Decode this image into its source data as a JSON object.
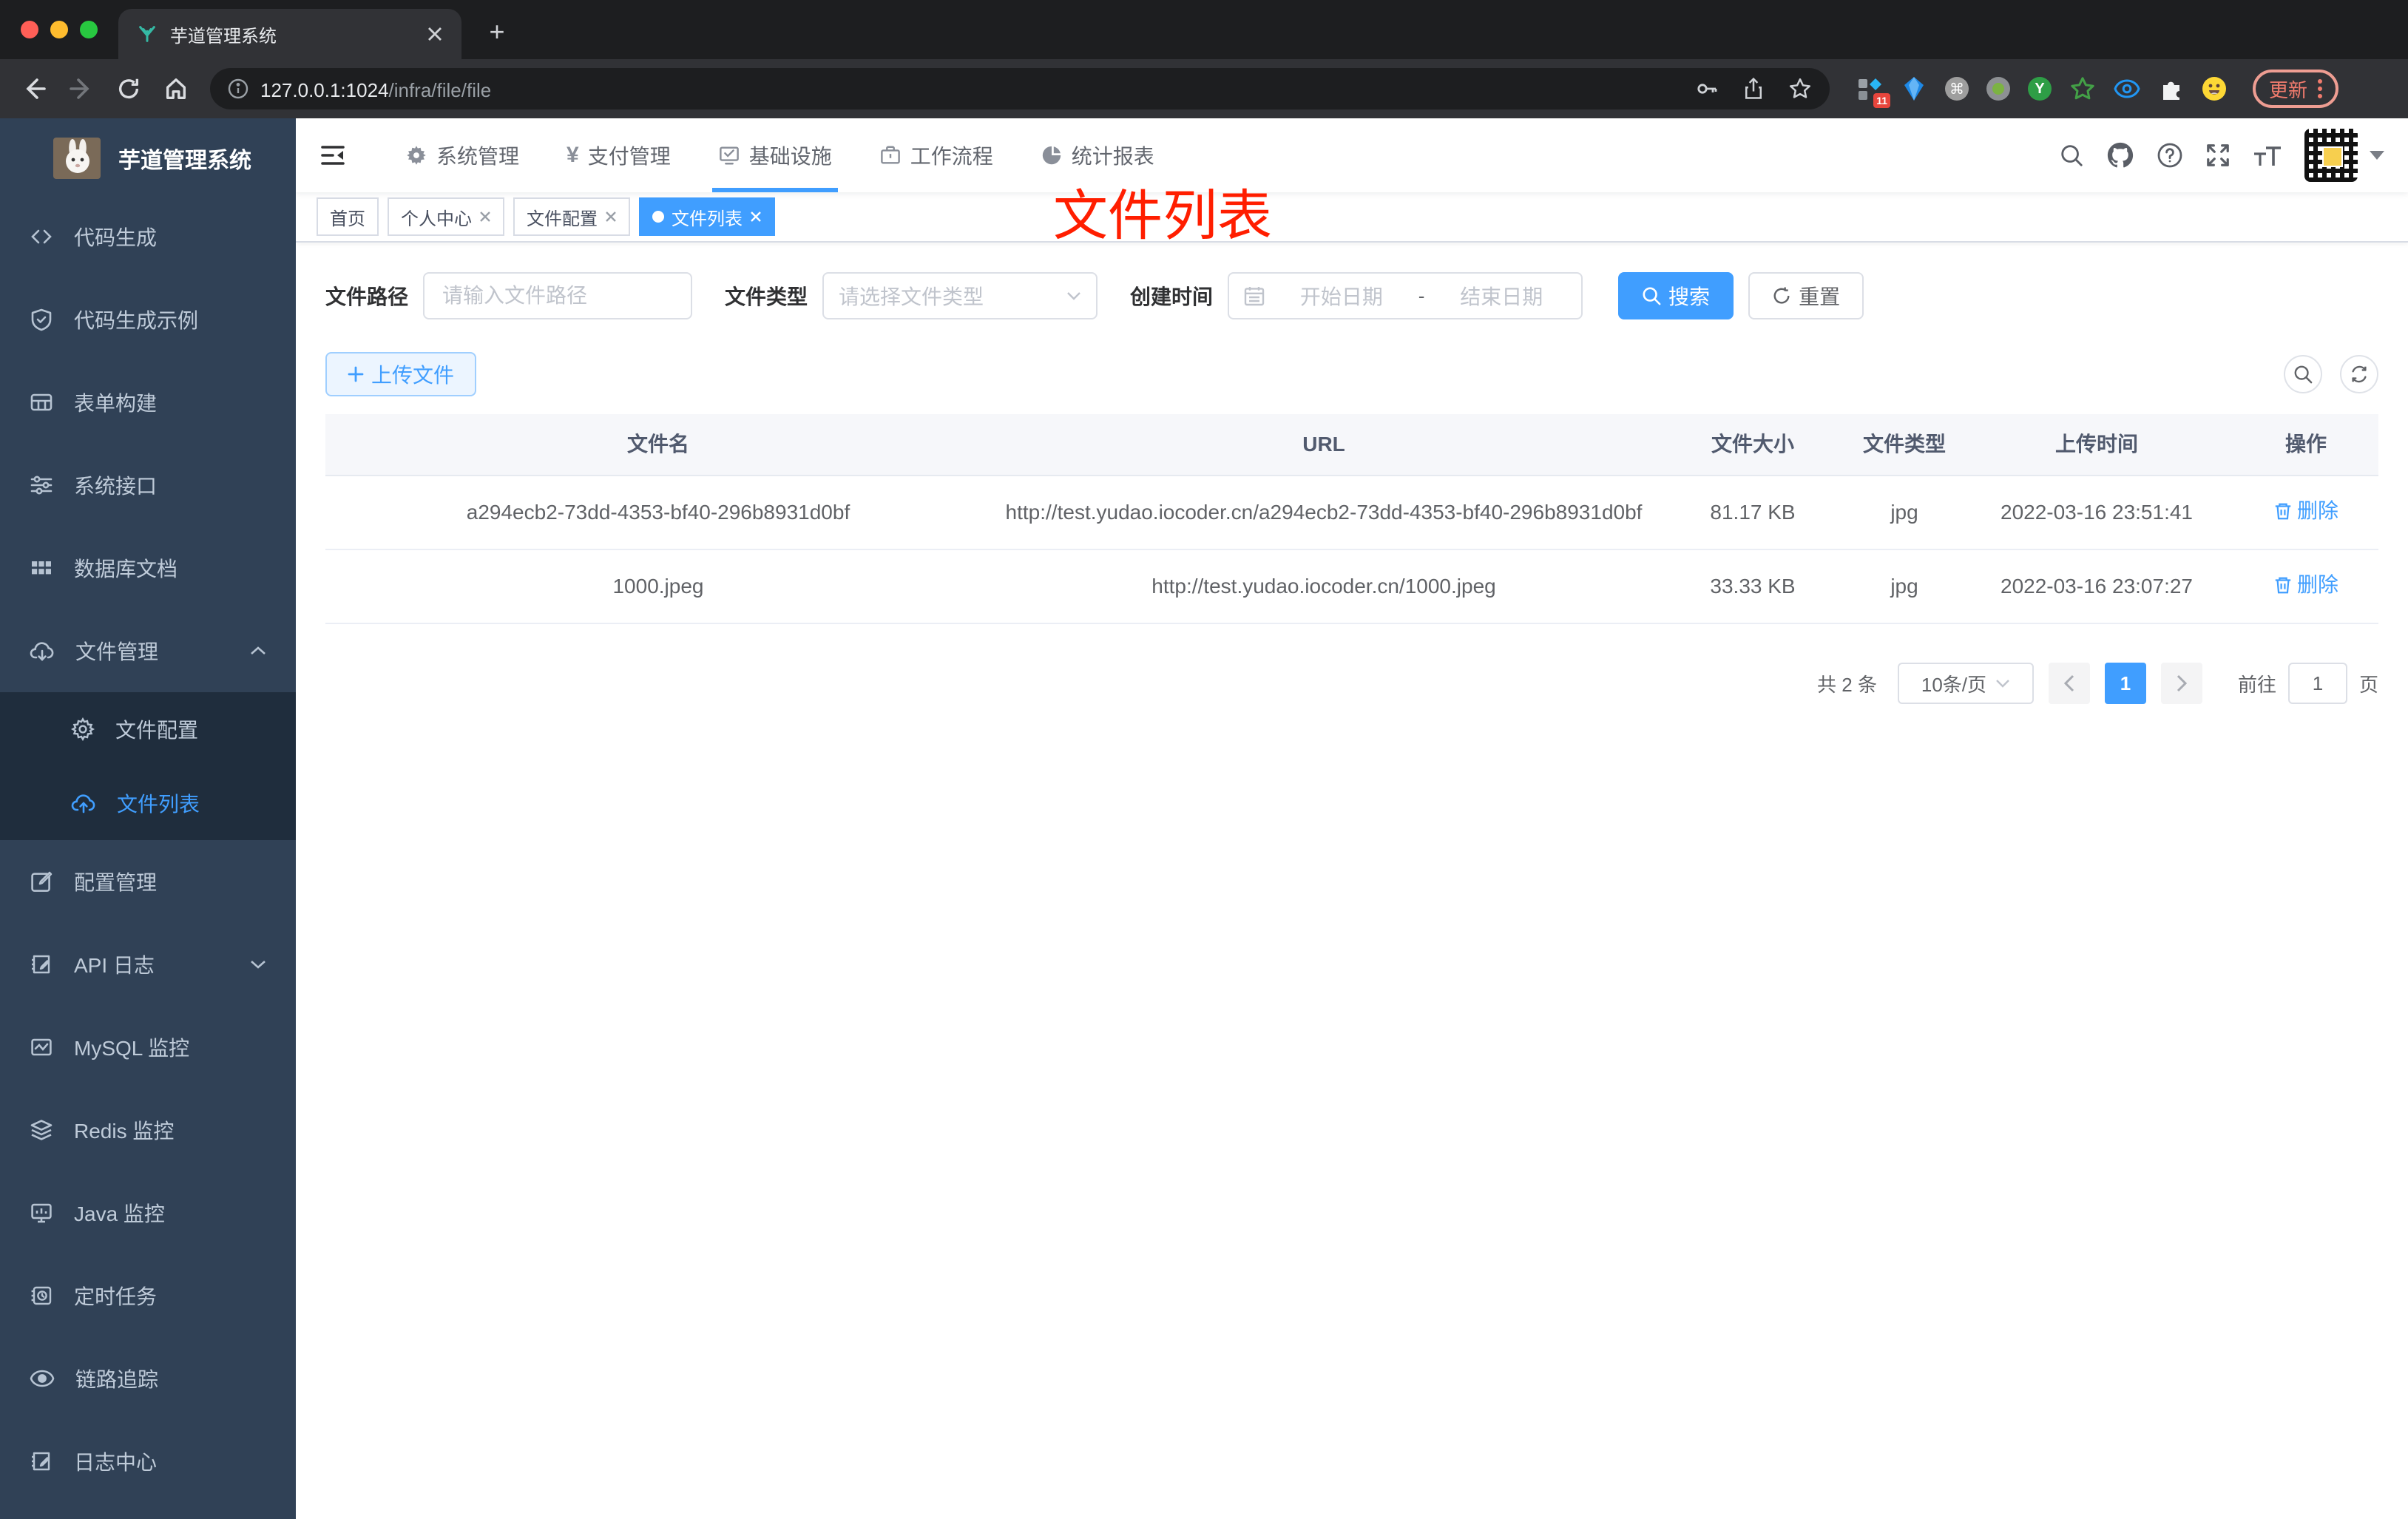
{
  "colors": {
    "accent": "#409eff",
    "annotation_red": "#ff1e00",
    "sidebar_bg": "#304156",
    "submenu_bg": "#1f2d3d"
  },
  "browser": {
    "tab_title": "芋道管理系统",
    "url_host": "127.0.0.1:1024",
    "url_path": "/infra/file/file",
    "ext_badge": "11",
    "update_label": "更新"
  },
  "sidebar": {
    "title": "芋道管理系统",
    "items": [
      {
        "label": "代码生成"
      },
      {
        "label": "代码生成示例"
      },
      {
        "label": "表单构建"
      },
      {
        "label": "系统接口"
      },
      {
        "label": "数据库文档"
      },
      {
        "label": "文件管理"
      },
      {
        "label": "文件配置"
      },
      {
        "label": "文件列表"
      },
      {
        "label": "配置管理"
      },
      {
        "label": "API 日志"
      },
      {
        "label": "MySQL 监控"
      },
      {
        "label": "Redis 监控"
      },
      {
        "label": "Java 监控"
      },
      {
        "label": "定时任务"
      },
      {
        "label": "链路追踪"
      },
      {
        "label": "日志中心"
      }
    ]
  },
  "topnav": {
    "items": [
      {
        "label": "系统管理"
      },
      {
        "label": "支付管理"
      },
      {
        "label": "基础设施"
      },
      {
        "label": "工作流程"
      },
      {
        "label": "统计报表"
      }
    ]
  },
  "tags": {
    "items": [
      {
        "label": "首页"
      },
      {
        "label": "个人中心"
      },
      {
        "label": "文件配置"
      },
      {
        "label": "文件列表"
      }
    ]
  },
  "annotation": {
    "text": "文件列表"
  },
  "filter": {
    "path_label": "文件路径",
    "path_placeholder": "请输入文件路径",
    "type_label": "文件类型",
    "type_placeholder": "请选择文件类型",
    "time_label": "创建时间",
    "start_placeholder": "开始日期",
    "range_separator": "-",
    "end_placeholder": "结束日期",
    "search_label": "搜索",
    "reset_label": "重置"
  },
  "actions": {
    "upload_label": "上传文件"
  },
  "table": {
    "columns": [
      {
        "label": "文件名"
      },
      {
        "label": "URL"
      },
      {
        "label": "文件大小"
      },
      {
        "label": "文件类型"
      },
      {
        "label": "上传时间"
      },
      {
        "label": "操作"
      }
    ],
    "rows": [
      {
        "name": "a294ecb2-73dd-4353-bf40-296b8931d0bf",
        "url": "http://test.yudao.iocoder.cn/a294ecb2-73dd-4353-bf40-296b8931d0bf",
        "size": "81.17 KB",
        "type": "jpg",
        "time": "2022-03-16 23:51:41",
        "action": "删除"
      },
      {
        "name": "1000.jpeg",
        "url": "http://test.yudao.iocoder.cn/1000.jpeg",
        "size": "33.33 KB",
        "type": "jpg",
        "time": "2022-03-16 23:07:27",
        "action": "删除"
      }
    ]
  },
  "pagination": {
    "total": "共 2 条",
    "page_size": "10条/页",
    "current_page": "1",
    "goto_label": "前往",
    "goto_value": "1",
    "page_unit": "页"
  }
}
